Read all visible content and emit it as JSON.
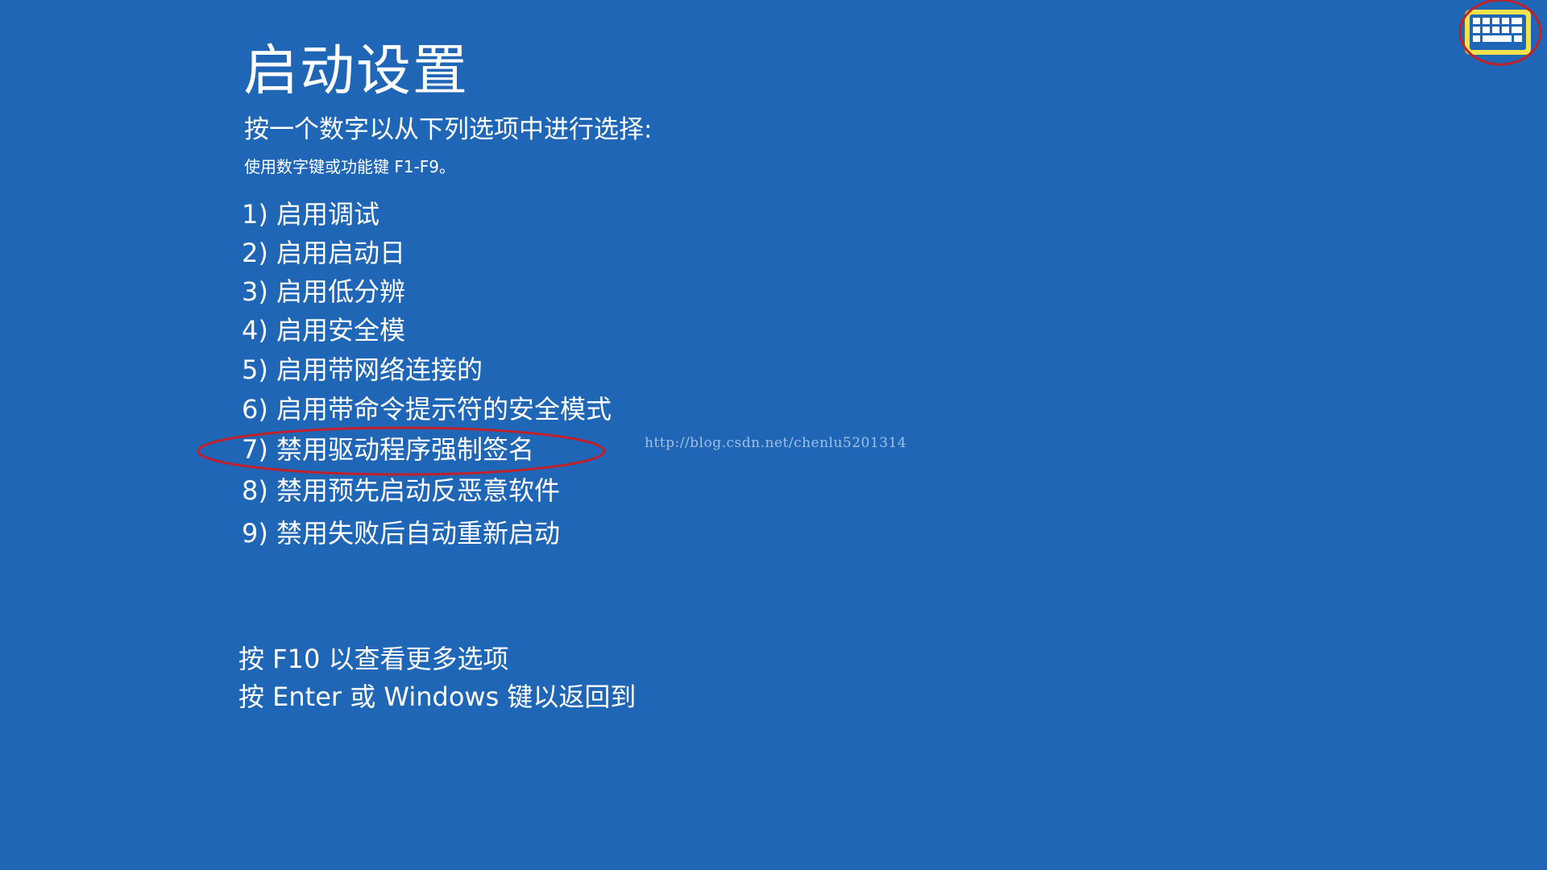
{
  "screen": {
    "title": "启动设置",
    "subtitle": "按一个数字以从下列选项中进行选择:",
    "hint": "使用数字键或功能键 F1-F9。"
  },
  "options": [
    {
      "label": "1) 启用调试"
    },
    {
      "label": "2) 启用启动日"
    },
    {
      "label": "3) 启用低分辨"
    },
    {
      "label": "4) 启用安全模"
    },
    {
      "label": "5) 启用带网络连接的"
    },
    {
      "label": "6) 启用带命令提示符的安全模式"
    },
    {
      "label": "7) 禁用驱动程序强制签名"
    },
    {
      "label": "8) 禁用预先启动反恶意软件"
    },
    {
      "label": "9) 禁用失败后自动重新启动"
    }
  ],
  "footer": {
    "more_options": "按 F10 以查看更多选项",
    "return": "按 Enter 或 Windows 键以返回到"
  },
  "watermark": "http://blog.csdn.net/chenlu5201314",
  "icons": {
    "keyboard": "keyboard-icon"
  },
  "colors": {
    "background": "#1f66b6",
    "text": "#ffffff",
    "annotation": "#c0202a",
    "keyboard_icon": "#f4e24a"
  }
}
